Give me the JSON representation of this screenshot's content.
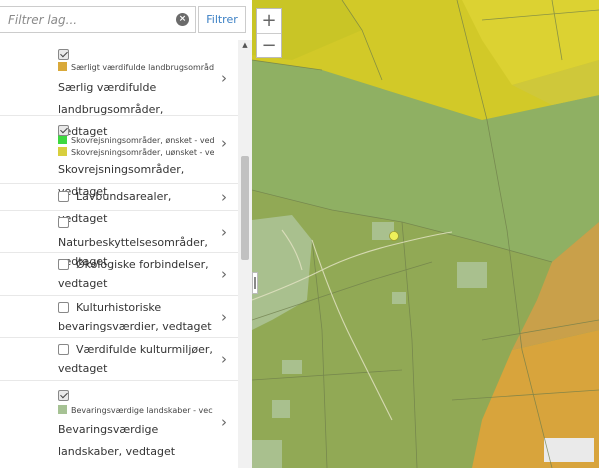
{
  "filter": {
    "placeholder": "Filtrer lag...",
    "button_label": "Filtrer",
    "clear_icon": "×"
  },
  "layers": [
    {
      "checked": true,
      "legend": [
        {
          "color": "#d9a93a",
          "label": "Særligt værdifulde landbrugsområder - ve"
        }
      ],
      "title": "Særlig værdifulde landbrugsområder, vedtaget"
    },
    {
      "checked": true,
      "legend": [
        {
          "color": "#3ed840",
          "label": "Skovrejsningsområder, ønsket - vedt"
        },
        {
          "color": "#d8cf3e",
          "label": "Skovrejsningsområder, uønsket - vec"
        }
      ],
      "title": "Skovrejsningsområder, vedtaget"
    },
    {
      "checked": false,
      "title": "Lavbundsarealer, vedtaget"
    },
    {
      "checked": false,
      "title_line1": "Naturbeskyttelsesområder,",
      "title_line2": "vedtaget"
    },
    {
      "checked": false,
      "title_line1": "Økologiske forbindelser,",
      "title_line2": "vedtaget"
    },
    {
      "checked": false,
      "title_line1": "Kulturhistoriske",
      "title_line2": "bevaringsværdier, vedtaget"
    },
    {
      "checked": false,
      "title_line1": "Værdifulde kulturmiljøer,",
      "title_line2": "vedtaget"
    },
    {
      "checked": true,
      "legend": [
        {
          "color": "#a6c294",
          "label": "Bevaringsværdige landskaber - vec"
        }
      ],
      "title": "Bevaringsværdige landskaber, vedtaget"
    }
  ],
  "icons": {
    "chevron": "›",
    "scroll_up": "▲"
  },
  "zoom": {
    "in": "+",
    "out": "−"
  },
  "map_colors": {
    "yellow": "#d2c928",
    "yellow_light": "#e4da3c",
    "green": "#91a955",
    "pale_green": "#a9c08e",
    "orange": "#d8a43c",
    "marker": "#eef05a"
  }
}
